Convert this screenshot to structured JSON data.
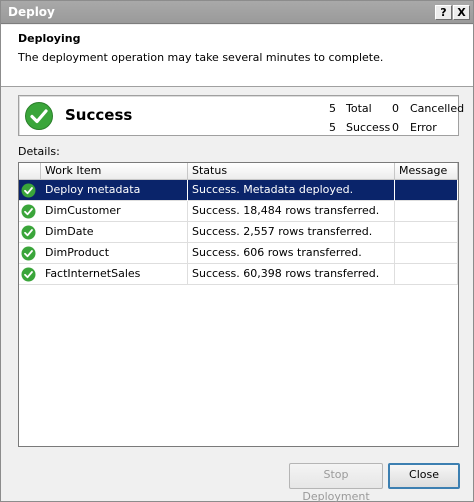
{
  "window": {
    "title": "Deploy",
    "help_label": "?",
    "close_label": "X"
  },
  "header": {
    "title": "Deploying",
    "subtitle": "The deployment operation may take several minutes to complete."
  },
  "summary": {
    "status": "Success",
    "total_value": "5",
    "total_label": "Total",
    "success_value": "5",
    "success_label": "Success",
    "cancelled_value": "0",
    "cancelled_label": "Cancelled",
    "error_value": "0",
    "error_label": "Error"
  },
  "details": {
    "label": "Details:",
    "columns": [
      "Work Item",
      "Status",
      "Message"
    ],
    "rows": [
      {
        "item": "Deploy metadata",
        "status": "Success. Metadata deployed.",
        "message": "",
        "selected": true
      },
      {
        "item": "DimCustomer",
        "status": "Success. 18,484 rows transferred.",
        "message": "",
        "selected": false
      },
      {
        "item": "DimDate",
        "status": "Success. 2,557 rows transferred.",
        "message": "",
        "selected": false
      },
      {
        "item": "DimProduct",
        "status": "Success. 606 rows transferred.",
        "message": "",
        "selected": false
      },
      {
        "item": "FactInternetSales",
        "status": "Success. 60,398 rows transferred.",
        "message": "",
        "selected": false
      }
    ]
  },
  "buttons": {
    "stop_label": "Stop Deployment",
    "close_label": "Close"
  },
  "colors": {
    "success_green": "#3aa53a",
    "selection": "#0a246a"
  },
  "icons": {
    "summary": "success-check-icon",
    "row": "success-check-icon"
  }
}
